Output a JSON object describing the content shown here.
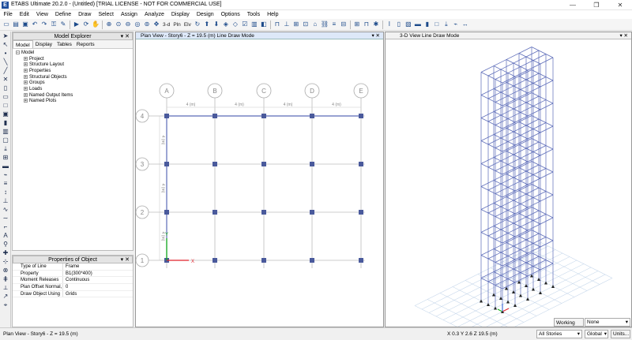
{
  "app": {
    "icon_letter": "E",
    "title": "ETABS Ultimate 20.2.0 - (Untitled)  [TRIAL LICENSE - NOT FOR COMMERCIAL USE]"
  },
  "window_controls": {
    "minimize": "—",
    "maximize": "❐",
    "close": "✕"
  },
  "menu": [
    "File",
    "Edit",
    "View",
    "Define",
    "Draw",
    "Select",
    "Assign",
    "Analyze",
    "Display",
    "Design",
    "Options",
    "Tools",
    "Help"
  ],
  "toolbar": {
    "btn_3d": "3-d",
    "btn_plan": "Pln",
    "btn_elev": "Elv"
  },
  "explorer": {
    "title": "Model Explorer",
    "tabs": [
      "Model",
      "Display",
      "Tables",
      "Reports"
    ],
    "root": "Model",
    "items": [
      "Project",
      "Structure Layout",
      "Properties",
      "Structural Objects",
      "Groups",
      "Loads",
      "Named Output Items",
      "Named Plots"
    ]
  },
  "properties": {
    "title": "Properties of Object",
    "rows": [
      {
        "key": "Type of Line",
        "value": "Frame"
      },
      {
        "key": "Property",
        "value": "B1(300*400)"
      },
      {
        "key": "Moment Releases",
        "value": "Continuous"
      },
      {
        "key": "Plan Offset Normal, mm",
        "value": "0"
      },
      {
        "key": "Draw Object Using",
        "value": "Grids"
      }
    ]
  },
  "plan_view": {
    "title": "Plan View - Story6 - Z = 19.5 (m)  Line Draw Mode",
    "grid_x": [
      "A",
      "B",
      "C",
      "D",
      "E"
    ],
    "grid_y": [
      "4",
      "3",
      "2",
      "1"
    ],
    "spacing_label": "4 (m)",
    "axis_x": "X",
    "axis_y": "Y"
  },
  "view_3d": {
    "title": "3-D View  Line Draw Mode",
    "stories": 10
  },
  "status": {
    "left": "Plan View - Story6 - Z = 19.5 (m)",
    "coords": "X 0.3  Y 2.6  Z 19.5 (m)",
    "stories": "All Stories",
    "global": "Global",
    "units": "Units..."
  },
  "working_plane": {
    "label": "Working Plane",
    "value": "None"
  },
  "colors": {
    "grid_line": "#bbbbbb",
    "beam": "#5a6ab8",
    "joint": "#4a5a9c",
    "axis_x": "#e0202a",
    "axis_y": "#10b010"
  }
}
